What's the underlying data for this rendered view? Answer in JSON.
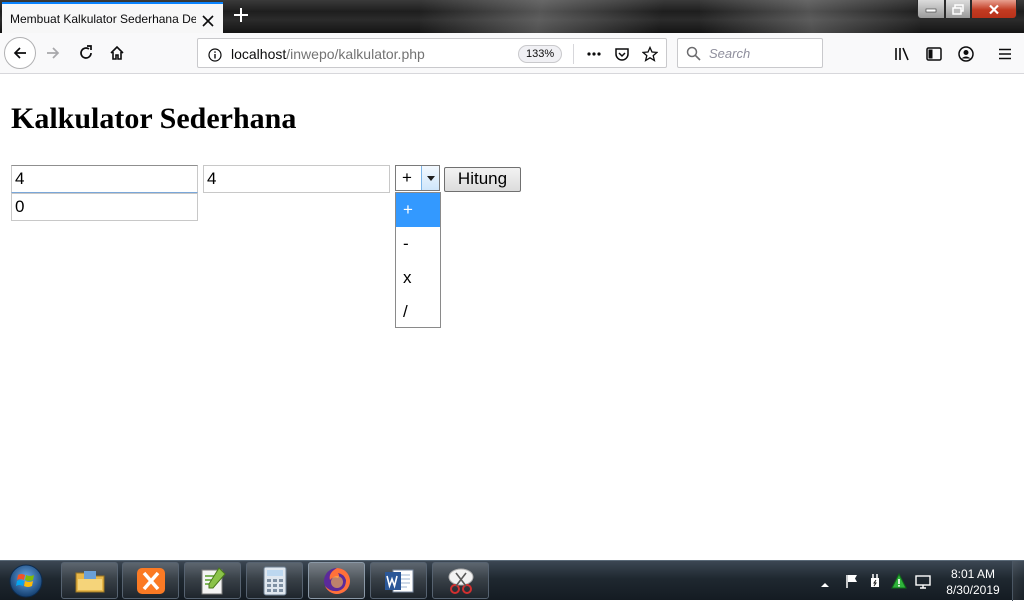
{
  "browser": {
    "tab": {
      "title": "Membuat Kalkulator Sederhana Dengan PHP"
    },
    "url": {
      "host": "localhost",
      "path": "/inwepo/kalkulator.php"
    },
    "zoom": "133%",
    "search": {
      "placeholder": "Search"
    },
    "accent": "#0a84ff"
  },
  "page": {
    "title": "Kalkulator Sederhana",
    "inputs": {
      "first": "4",
      "second": "4",
      "result": "0"
    },
    "operator": {
      "selected": "+",
      "options": [
        "+",
        "-",
        "x",
        "/"
      ]
    },
    "submit_label": "Hitung",
    "highlight_color": "#3399ff"
  },
  "taskbar": {
    "time": "8:01 AM",
    "date": "8/30/2019",
    "apps": [
      "file-explorer",
      "xampp",
      "notepad-plus-plus",
      "calculator",
      "firefox",
      "microsoft-word",
      "snipping-tool"
    ]
  }
}
